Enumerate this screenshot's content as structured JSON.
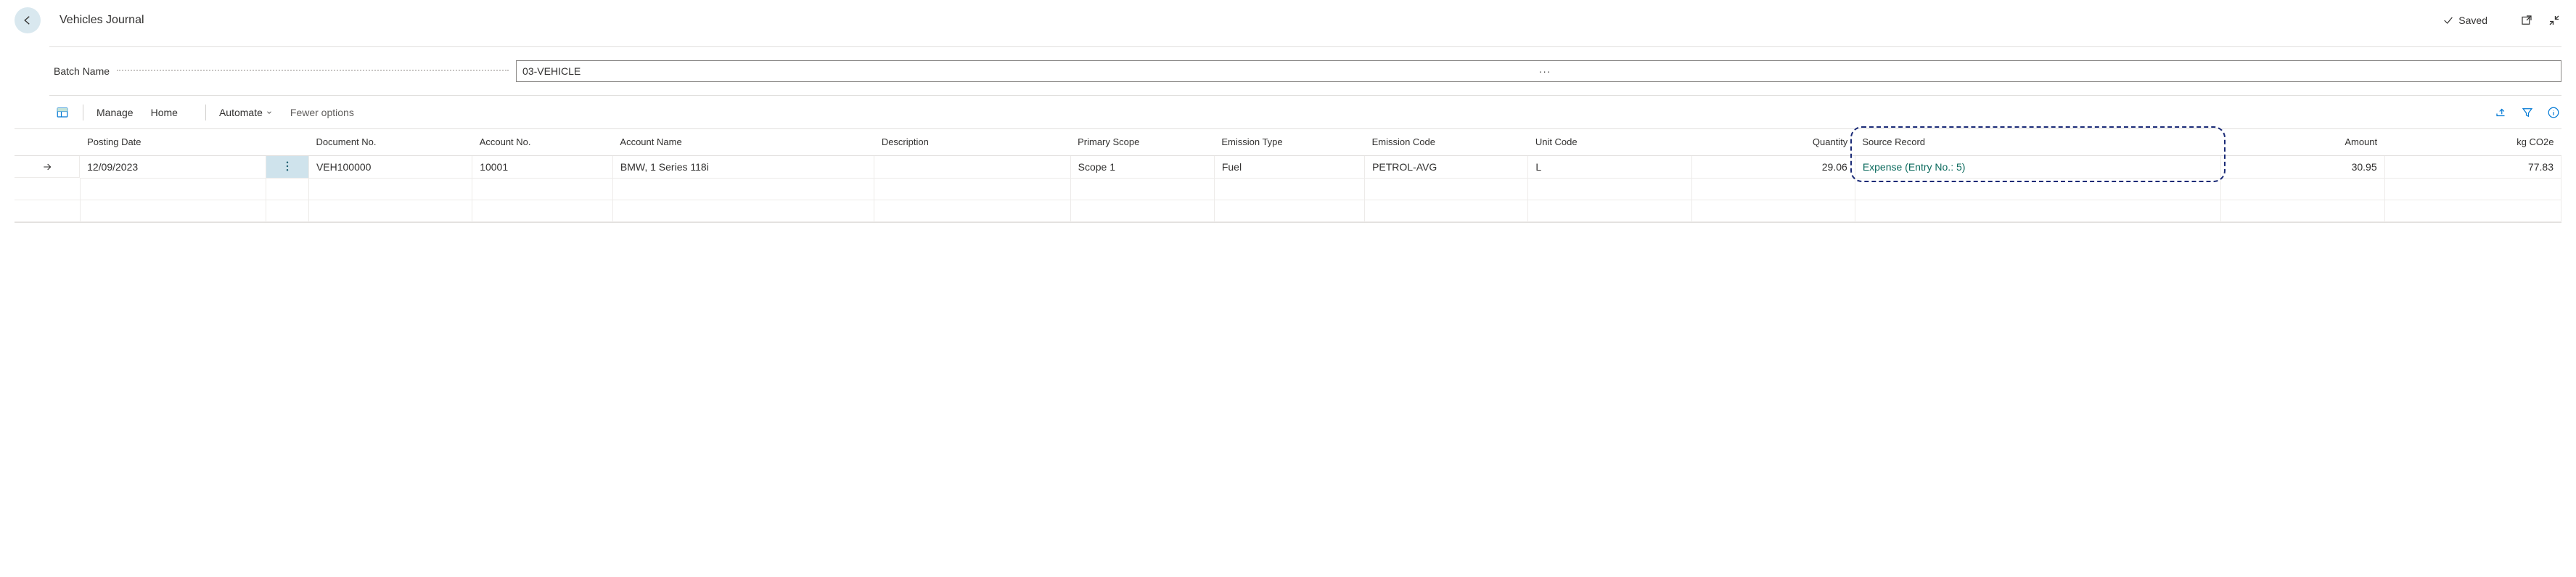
{
  "header": {
    "title": "Vehicles Journal",
    "saved_text": "Saved"
  },
  "batch": {
    "label": "Batch Name",
    "value": "03-VEHICLE"
  },
  "toolbar": {
    "manage": "Manage",
    "home": "Home",
    "automate": "Automate",
    "fewer": "Fewer options"
  },
  "grid": {
    "columns": {
      "posting_date": "Posting Date",
      "document_no": "Document No.",
      "account_no": "Account No.",
      "account_name": "Account Name",
      "description": "Description",
      "primary_scope": "Primary Scope",
      "emission_type": "Emission Type",
      "emission_code": "Emission Code",
      "unit_code": "Unit Code",
      "quantity": "Quantity",
      "source_record": "Source Record",
      "amount": "Amount",
      "kg_co2e": "kg CO2e"
    },
    "rows": [
      {
        "posting_date": "12/09/2023",
        "document_no": "VEH100000",
        "account_no": "10001",
        "account_name": "BMW, 1 Series 118i",
        "description": "",
        "primary_scope": "Scope 1",
        "emission_type": "Fuel",
        "emission_code": "PETROL-AVG",
        "unit_code": "L",
        "quantity": "29.06",
        "source_record": "Expense (Entry No.: 5)",
        "amount": "30.95",
        "kg_co2e": "77.83"
      }
    ]
  }
}
